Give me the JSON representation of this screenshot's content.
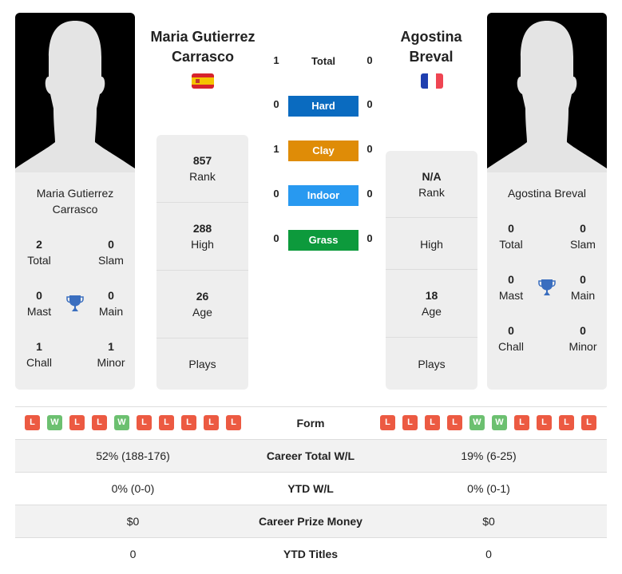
{
  "player1": {
    "name_line1": "Maria Gutierrez",
    "name_line2": "Carrasco",
    "card_name_line1": "Maria Gutierrez",
    "card_name_line2": "Carrasco",
    "flag": "Spain",
    "stats": {
      "total": {
        "value": "2",
        "label": "Total"
      },
      "slam": {
        "value": "0",
        "label": "Slam"
      },
      "mast": {
        "value": "0",
        "label": "Mast"
      },
      "main": {
        "value": "0",
        "label": "Main"
      },
      "chall": {
        "value": "1",
        "label": "Chall"
      },
      "minor": {
        "value": "1",
        "label": "Minor"
      }
    },
    "panel": {
      "rank": {
        "value": "857",
        "label": "Rank"
      },
      "high": {
        "value": "288",
        "label": "High"
      },
      "age": {
        "value": "26",
        "label": "Age"
      },
      "plays": {
        "value": "",
        "label": "Plays"
      }
    },
    "form": [
      "L",
      "W",
      "L",
      "L",
      "W",
      "L",
      "L",
      "L",
      "L",
      "L"
    ]
  },
  "player2": {
    "name_line1": "Agostina",
    "name_line2": "Breval",
    "card_name_line1": "Agostina Breval",
    "flag": "France",
    "stats": {
      "total": {
        "value": "0",
        "label": "Total"
      },
      "slam": {
        "value": "0",
        "label": "Slam"
      },
      "mast": {
        "value": "0",
        "label": "Mast"
      },
      "main": {
        "value": "0",
        "label": "Main"
      },
      "chall": {
        "value": "0",
        "label": "Chall"
      },
      "minor": {
        "value": "0",
        "label": "Minor"
      }
    },
    "panel": {
      "rank": {
        "value": "N/A",
        "label": "Rank"
      },
      "high": {
        "value": "",
        "label": "High"
      },
      "age": {
        "value": "18",
        "label": "Age"
      },
      "plays": {
        "value": "",
        "label": "Plays"
      }
    },
    "form": [
      "L",
      "L",
      "L",
      "L",
      "W",
      "W",
      "L",
      "L",
      "L",
      "L"
    ]
  },
  "h2h": {
    "total": {
      "label": "Total",
      "p1": "1",
      "p2": "0"
    },
    "surfaces": [
      {
        "label": "Hard",
        "p1": "0",
        "p2": "0",
        "color": "#0a6bc0"
      },
      {
        "label": "Clay",
        "p1": "1",
        "p2": "0",
        "color": "#df8c07"
      },
      {
        "label": "Indoor",
        "p1": "0",
        "p2": "0",
        "color": "#2899f0"
      },
      {
        "label": "Grass",
        "p1": "0",
        "p2": "0",
        "color": "#0d9a3c"
      }
    ]
  },
  "comparison": {
    "form_label": "Form",
    "rows": [
      {
        "label": "Career Total W/L",
        "p1": "52% (188-176)",
        "p2": "19% (6-25)"
      },
      {
        "label": "YTD W/L",
        "p1": "0% (0-0)",
        "p2": "0% (0-1)"
      },
      {
        "label": "Career Prize Money",
        "p1": "$0",
        "p2": "$0"
      },
      {
        "label": "YTD Titles",
        "p1": "0",
        "p2": "0"
      }
    ]
  }
}
